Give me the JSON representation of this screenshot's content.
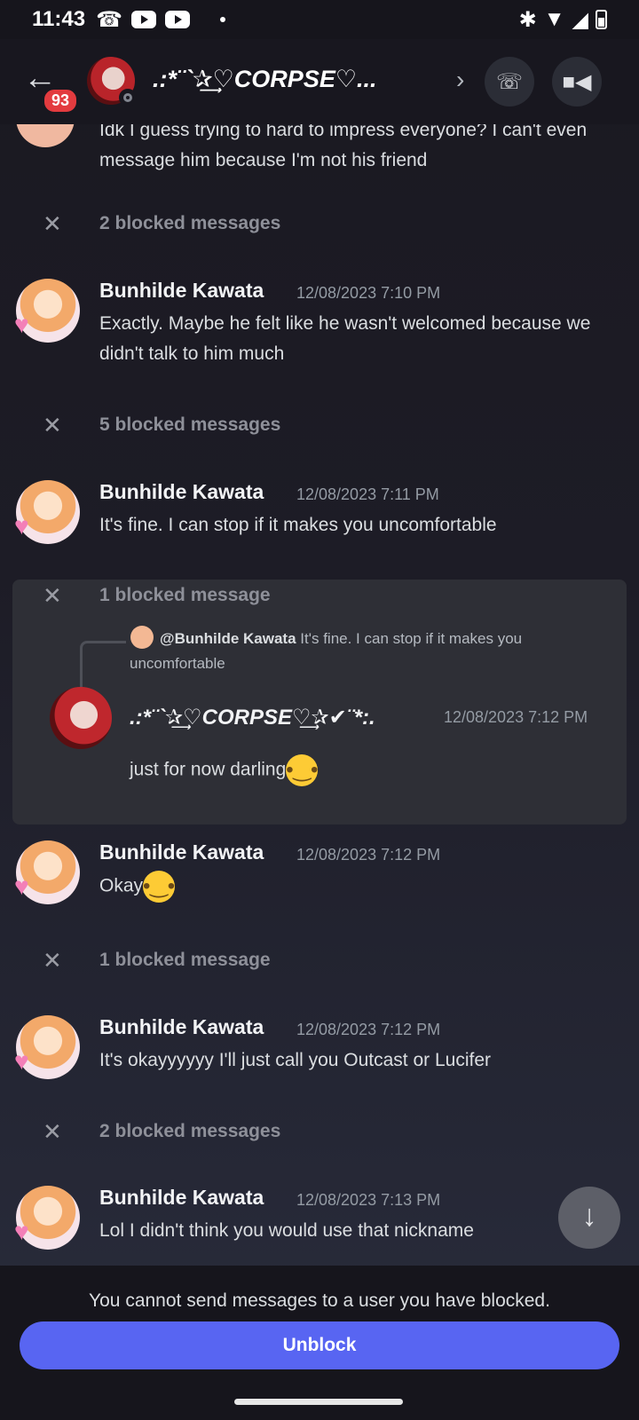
{
  "status_bar": {
    "time": "11:43"
  },
  "header": {
    "back_icon": "arrow-left-icon",
    "unread_count": "93",
    "channel_name": ".:*¨`✰͢♡CORPSE♡...",
    "chevron": "›",
    "call_icon": "phone-icon",
    "video_icon": "video-camera-icon"
  },
  "messages": {
    "partial_text": "Idk I guess trying to hard to impress everyone? I can't even message him because I'm not his friend",
    "blocked_1": "2 blocked messages",
    "m1": {
      "user": "Bunhilde Kawata",
      "time": "12/08/2023 7:10 PM",
      "text": "Exactly. Maybe he felt like he wasn't welcomed because we didn't talk to him much"
    },
    "blocked_2": "5 blocked messages",
    "m2": {
      "user": "Bunhilde Kawata",
      "time": "12/08/2023 7:11 PM",
      "text": "It's fine. I can stop if it makes you uncomfortable"
    },
    "blocked_3": "1 blocked message",
    "reply": {
      "user": "@Bunhilde Kawata",
      "text": "It's fine. I can stop if it makes you uncomfortable"
    },
    "corpse": {
      "user": ".:*¨`✰͢♡CORPSE♡͢✰✔¨*:.",
      "time": "12/08/2023 7:12 PM",
      "text": "just for now darling"
    },
    "m3": {
      "user": "Bunhilde Kawata",
      "time": "12/08/2023 7:12 PM",
      "text": "Okay"
    },
    "blocked_4": "1 blocked message",
    "m4": {
      "user": "Bunhilde Kawata",
      "time": "12/08/2023 7:12 PM",
      "text": "It's okayyyyyy I'll just call you Outcast or Lucifer"
    },
    "blocked_5": "2 blocked messages",
    "m5": {
      "user": "Bunhilde Kawata",
      "time": "12/08/2023 7:13 PM",
      "text": "Lol I didn't think you would use that nickname"
    }
  },
  "footer": {
    "note": "You cannot send messages to a user you have blocked.",
    "unblock_label": "Unblock"
  },
  "colors": {
    "accent": "#5865f2",
    "badge": "#e33b3f",
    "background": "#1d1c26"
  }
}
